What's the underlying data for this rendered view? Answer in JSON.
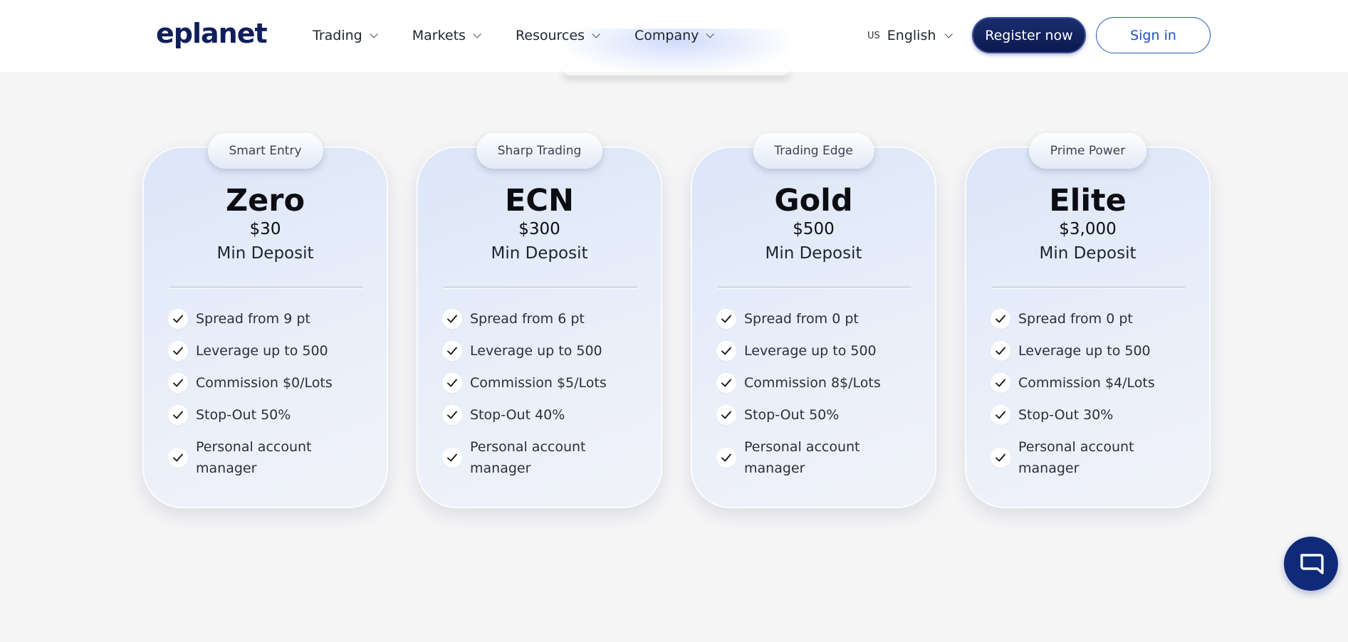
{
  "header": {
    "logo_text": "eplanet",
    "nav": [
      {
        "label": "Trading"
      },
      {
        "label": "Markets"
      },
      {
        "label": "Resources"
      },
      {
        "label": "Company"
      }
    ],
    "language": {
      "flag": "US",
      "label": "English"
    },
    "register_label": "Register now",
    "signin_label": "Sign in"
  },
  "plans": [
    {
      "badge": "Smart Entry",
      "name": "Zero",
      "price": "$30",
      "subtitle": "Min Deposit",
      "features": [
        "Spread from 9 pt",
        "Leverage up to 500",
        "Commission $0/Lots",
        "Stop-Out 50%",
        "Personal account manager"
      ]
    },
    {
      "badge": "Sharp Trading",
      "name": "ECN",
      "price": "$300",
      "subtitle": "Min Deposit",
      "features": [
        "Spread from 6 pt",
        "Leverage up to 500",
        "Commission $5/Lots",
        "Stop-Out 40%",
        "Personal account manager"
      ]
    },
    {
      "badge": "Trading Edge",
      "name": "Gold",
      "price": "$500",
      "subtitle": "Min Deposit",
      "features": [
        "Spread from 0 pt",
        "Leverage up to 500",
        "Commission 8$/Lots",
        "Stop-Out 50%",
        "Personal account manager"
      ]
    },
    {
      "badge": "Prime Power",
      "name": "Elite",
      "price": "$3,000",
      "subtitle": "Min Deposit",
      "features": [
        "Spread from 0 pt",
        "Leverage up to 500",
        "Commission $4/Lots",
        "Stop-Out 30%",
        "Personal account manager"
      ]
    }
  ],
  "chat": {
    "icon": "chat-bubble-icon"
  },
  "colors": {
    "brand_navy": "#0f1f5c",
    "brand_orange": "#f2a23a",
    "register_bg": "#0b1a4e",
    "signin_border": "#2b55c8",
    "chat_bg": "#0f2a78",
    "page_bg": "#f5f5f6"
  }
}
